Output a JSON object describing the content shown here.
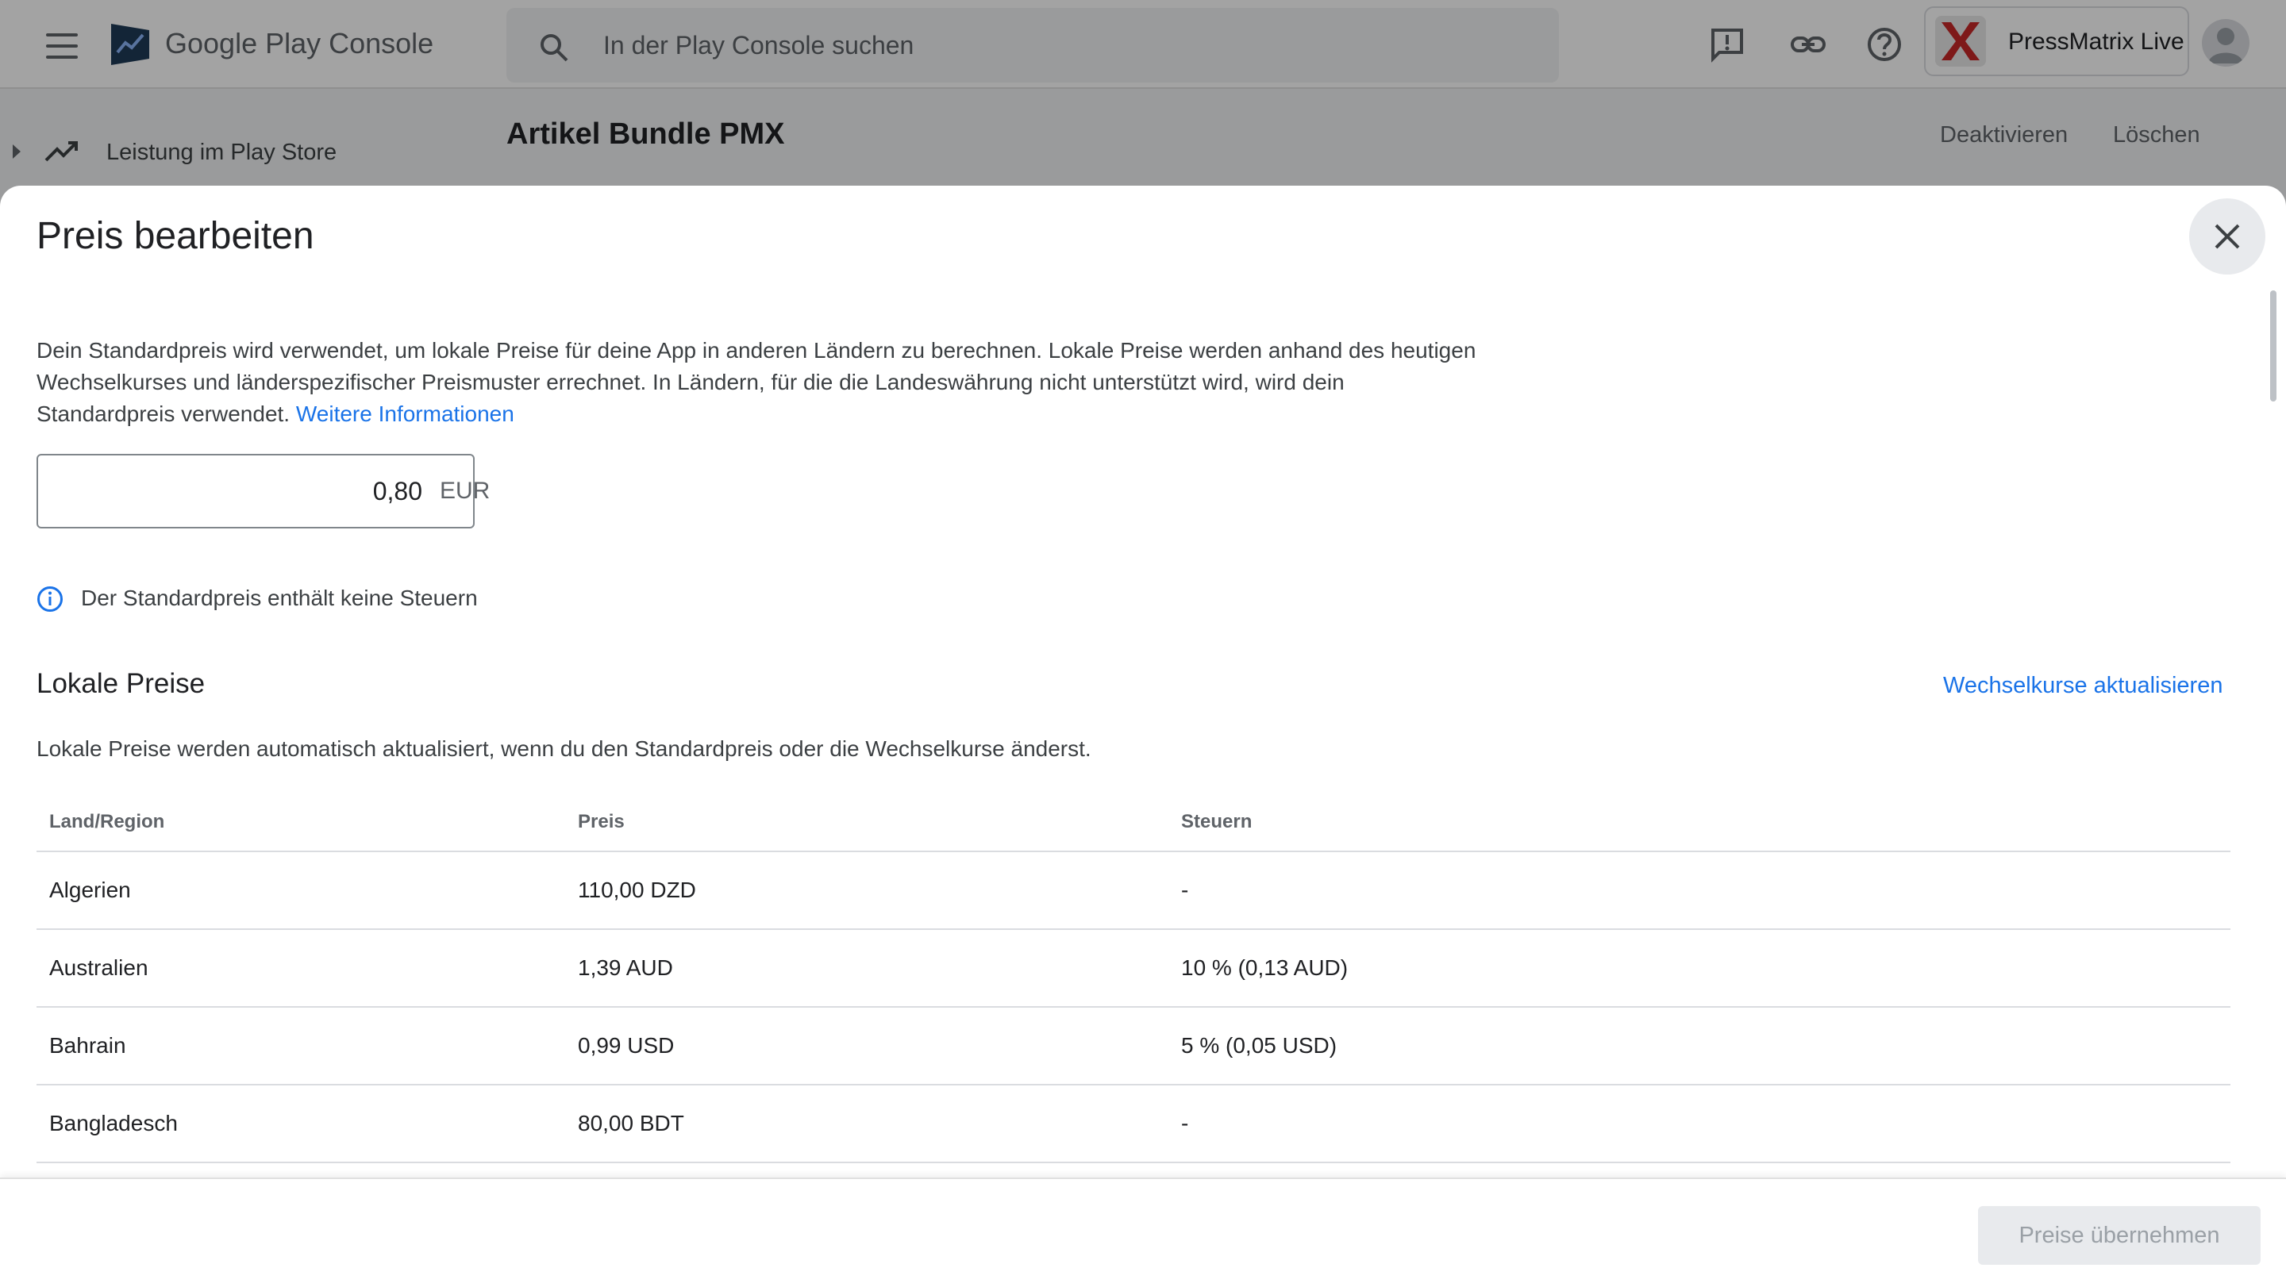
{
  "header": {
    "brand": "Google Play Console",
    "search_placeholder": "In der Play Console suchen",
    "account_name": "PressMatrix Live"
  },
  "sidebar": {
    "items": [
      {
        "label": "Leistung im Play Store"
      }
    ]
  },
  "page": {
    "title": "Artikel Bundle PMX",
    "actions": {
      "deactivate": "Deaktivieren",
      "delete": "Löschen"
    }
  },
  "dialog": {
    "title": "Preis bearbeiten",
    "description": "Dein Standardpreis wird verwendet, um lokale Preise für deine App in anderen Ländern zu berechnen. Lokale Preise werden anhand des heutigen Wechselkurses und länderspezifischer Preismuster errechnet. In Ländern, für die die Landeswährung nicht unterstützt wird, wird dein Standardpreis verwendet.",
    "more_info_link": "Weitere Informationen",
    "default_price": {
      "value": "0,80",
      "currency": "EUR"
    },
    "tax_note": "Der Standardpreis enthält keine Steuern",
    "local_prices": {
      "title": "Lokale Preise",
      "update_link": "Wechselkurse aktualisieren",
      "description": "Lokale Preise werden automatisch aktualisiert, wenn du den Standardpreis oder die Wechselkurse änderst.",
      "columns": [
        "Land/Region",
        "Preis",
        "Steuern"
      ],
      "rows": [
        [
          "Algerien",
          "110,00 DZD",
          "-"
        ],
        [
          "Australien",
          "1,39 AUD",
          "10 % (0,13 AUD)"
        ],
        [
          "Bahrain",
          "0,99 USD",
          "5 % (0,05 USD)"
        ],
        [
          "Bangladesch",
          "80,00 BDT",
          "-"
        ]
      ]
    },
    "apply_button": "Preise übernehmen"
  }
}
